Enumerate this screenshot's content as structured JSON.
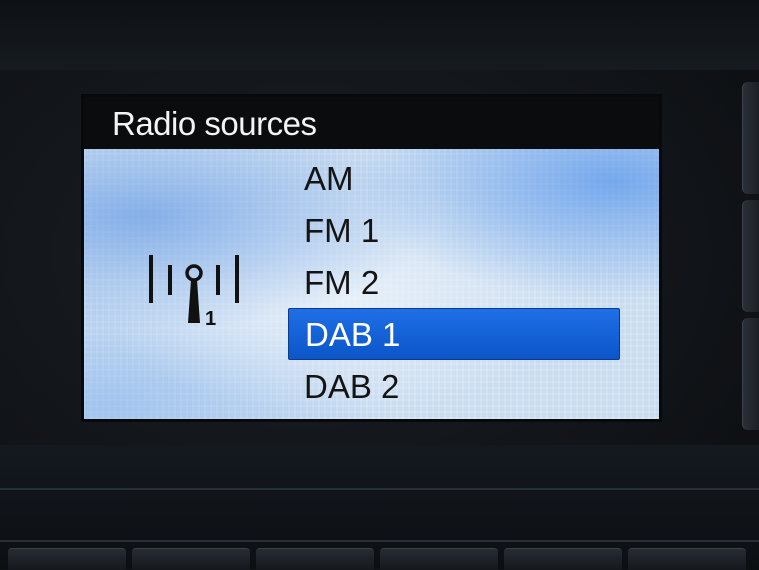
{
  "screen": {
    "title": "Radio sources",
    "icon": "antenna-icon",
    "icon_label": "1",
    "sources": [
      {
        "label": "AM",
        "selected": false
      },
      {
        "label": "FM 1",
        "selected": false
      },
      {
        "label": "FM 2",
        "selected": false
      },
      {
        "label": "DAB 1",
        "selected": true
      },
      {
        "label": "DAB 2",
        "selected": false
      }
    ],
    "colors": {
      "selection": "#1565d8",
      "title_bar": "#0b0c0e",
      "list_background": "#c9dcf0"
    }
  }
}
